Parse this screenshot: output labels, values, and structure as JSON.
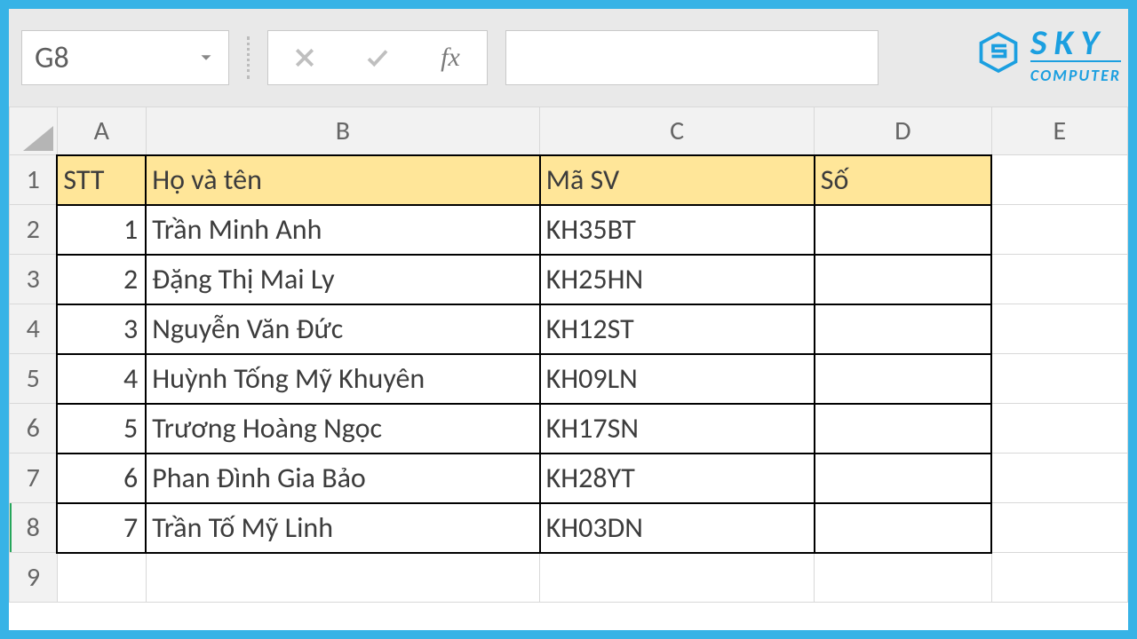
{
  "namebox": {
    "value": "G8"
  },
  "formula_bar": {
    "value": "",
    "fx_label": "fx"
  },
  "logo": {
    "line1": "SKY",
    "line2": "COMPUTER"
  },
  "columns": [
    "A",
    "B",
    "C",
    "D",
    "E"
  ],
  "col_widths": {
    "row": 54,
    "A": 100,
    "B": 444,
    "C": 310,
    "D": 200,
    "E": 154
  },
  "headers": {
    "A": "STT",
    "B": "Họ và tên",
    "C": "Mã SV",
    "D": "Số"
  },
  "rows": [
    {
      "n": 1,
      "A": "1",
      "B": "Trần Minh Anh",
      "C": "KH35BT",
      "D": ""
    },
    {
      "n": 2,
      "A": "2",
      "B": "Đặng Thị Mai Ly",
      "C": "KH25HN",
      "D": ""
    },
    {
      "n": 3,
      "A": "3",
      "B": "Nguyễn Văn Đức",
      "C": "KH12ST",
      "D": ""
    },
    {
      "n": 4,
      "A": "4",
      "B": "Huỳnh Tống Mỹ Khuyên",
      "C": "KH09LN",
      "D": ""
    },
    {
      "n": 5,
      "A": "5",
      "B": "Trương Hoàng Ngọc",
      "C": "KH17SN",
      "D": ""
    },
    {
      "n": 6,
      "A": "6",
      "B": "Phan Đình Gia Bảo",
      "C": "KH28YT",
      "D": ""
    },
    {
      "n": 7,
      "A": "7",
      "B": "Trần Tố Mỹ Linh",
      "C": "KH03DN",
      "D": ""
    }
  ],
  "trailing_rows": [
    9
  ],
  "selected_row": 8,
  "colors": {
    "accent": "#37b3e6",
    "header_fill": "#ffe699",
    "logo": "#1b9fe0"
  }
}
